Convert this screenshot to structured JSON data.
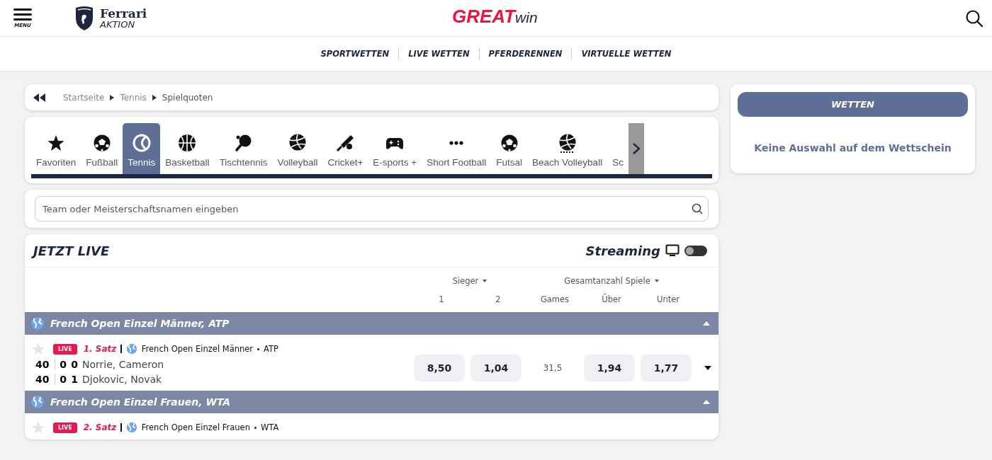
{
  "header": {
    "menu_label": "MENU",
    "brand_name": "Ferrari",
    "brand_sub": "AKTION",
    "logo_main": "GREAT",
    "logo_sub": "win"
  },
  "nav": [
    "SPORTWETTEN",
    "LIVE WETTEN",
    "PFERDERENNEN",
    "VIRTUELLE WETTEN"
  ],
  "breadcrumb": [
    "Startseite",
    "Tennis",
    "Spielquoten"
  ],
  "sports": [
    {
      "label": "Favoriten",
      "selected": false
    },
    {
      "label": "Fußball",
      "selected": false
    },
    {
      "label": "Tennis",
      "selected": true
    },
    {
      "label": "Basketball",
      "selected": false
    },
    {
      "label": "Tischtennis",
      "selected": false
    },
    {
      "label": "Volleyball",
      "selected": false
    },
    {
      "label": "Cricket+",
      "selected": false
    },
    {
      "label": "E-sports +",
      "selected": false
    },
    {
      "label": "Short Football",
      "selected": false
    },
    {
      "label": "Futsal",
      "selected": false
    },
    {
      "label": "Beach Volleyball",
      "selected": false
    },
    {
      "label": "Sc",
      "selected": false
    }
  ],
  "search": {
    "placeholder": "Team oder Meisterschaftsnamen eingeben"
  },
  "live": {
    "title": "JETZT LIVE",
    "streaming_label": "Streaming",
    "streaming_on": false,
    "market_1": "Sieger",
    "market_2": "Gesamtanzahl Spiele",
    "columns": [
      "1",
      "2",
      "Games",
      "Über",
      "Unter"
    ],
    "groups": [
      {
        "name": "French Open Einzel Männer, ATP",
        "expanded": true,
        "matches": [
          {
            "favorite": false,
            "live_badge": "LIVE",
            "period": "1. Satz",
            "competition": "French Open Einzel Männer",
            "tour": "ATP",
            "players": [
              {
                "points": "40",
                "games": "0",
                "sets": "0",
                "name": "Norrie, Cameron"
              },
              {
                "points": "40",
                "games": "0",
                "sets": "1",
                "name": "Djokovic, Novak"
              }
            ],
            "odds": [
              "8,50",
              "1,04"
            ],
            "line": "31,5",
            "totals": [
              "1,94",
              "1,77"
            ]
          }
        ]
      },
      {
        "name": "French Open Einzel Frauen, WTA",
        "expanded": true,
        "matches": [
          {
            "favorite": false,
            "live_badge": "LIVE",
            "period": "2. Satz",
            "competition": "French Open Einzel Frauen",
            "tour": "WTA"
          }
        ]
      }
    ]
  },
  "betslip": {
    "button": "WETTEN",
    "empty_text": "Keine Auswahl auf dem Wettschein"
  }
}
